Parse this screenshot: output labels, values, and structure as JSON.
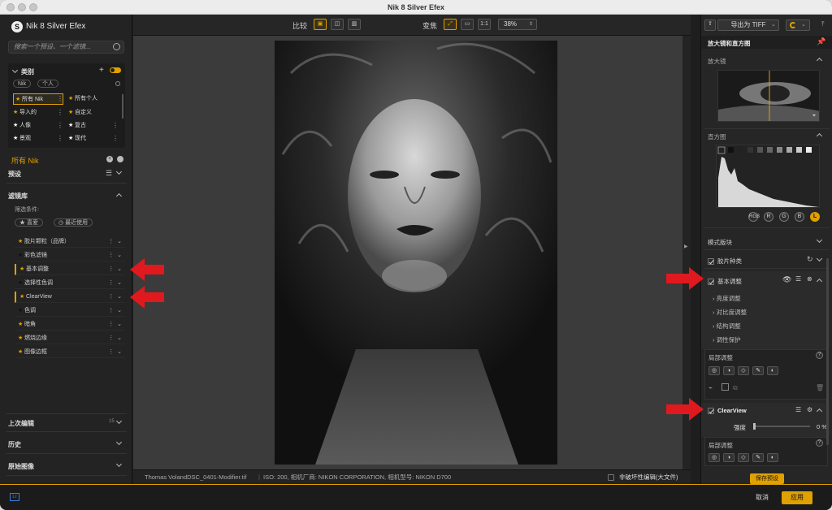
{
  "window": {
    "title": "Nik 8 Silver Efex"
  },
  "left_panel": {
    "app_name": "Nik 8 Silver Efex",
    "search_placeholder": "搜索一个预设、一个滤镜...",
    "category": {
      "title": "类别",
      "tags": [
        "Nik",
        "个人"
      ],
      "grid": [
        {
          "label": "所有 Nik",
          "selected": true
        },
        {
          "label": "所有个人",
          "selected": false
        },
        {
          "label": "导入的",
          "selected": false
        },
        {
          "label": "自定义",
          "selected": false
        },
        {
          "label": "人像",
          "selected": false
        },
        {
          "label": "复古",
          "selected": false
        },
        {
          "label": "景观",
          "selected": false
        },
        {
          "label": "现代",
          "selected": false
        }
      ]
    },
    "current_label": "所有 Nik",
    "presets_title": "预设",
    "filter_library": {
      "title": "滤镜库",
      "filter_condition": "筛选条件:",
      "filter_favorite": "喜爱",
      "filter_recent": "最近使用",
      "items": [
        {
          "label": "胶片颗粒（品牌）",
          "marked": false
        },
        {
          "label": "彩色滤镜",
          "marked": false
        },
        {
          "label": "基本调整",
          "marked": true
        },
        {
          "label": "选择性色调",
          "marked": false
        },
        {
          "label": "ClearView",
          "marked": true
        },
        {
          "label": "色调",
          "marked": false
        },
        {
          "label": "暗角",
          "marked": false
        },
        {
          "label": "燃烧边缘",
          "marked": false
        },
        {
          "label": "图像边框",
          "marked": false
        }
      ]
    },
    "history_sections": [
      {
        "label": "上次编辑",
        "count": "15"
      },
      {
        "label": "历史",
        "count": ""
      },
      {
        "label": "原始图像",
        "count": ""
      }
    ]
  },
  "toolbar": {
    "compare_label": "比较",
    "zoom_label": "变焦",
    "zoom_1to1": "1:1",
    "zoom_value": "38%"
  },
  "status_bar": {
    "filename": "Thomas VolandDSC_0401-Modifier.tif",
    "info": "ISO: 200, 相机厂商: NIKON CORPORATION, 相机型号: NIKON D700",
    "nondestructive_label": "非破坏性编辑(大文件)"
  },
  "right_panel": {
    "export_label": "导出为 TIFF",
    "loupe_header": "放大镜和直方图",
    "loupe_label": "放大镜",
    "histogram_label": "直方图",
    "channels": [
      "RGB",
      "R",
      "G",
      "B",
      "L"
    ],
    "mode_blocks_label": "模式版块",
    "film_type_label": "胶片种类",
    "basic_adjust_label": "基本调整",
    "basic_sub": [
      "亮度调整",
      "对比度调整",
      "结构调整",
      "调性保护"
    ],
    "local_adjust_label": "局部调整",
    "clearview_label": "ClearView",
    "strength_label": "强度",
    "strength_value": "0 %",
    "local_adjust_label2": "局部调整",
    "save_preset": "保存预设"
  },
  "bottom_bar": {
    "cancel": "取消",
    "apply": "应用"
  },
  "colors": {
    "accent": "#e0a000",
    "arrow": "#e0191e"
  }
}
